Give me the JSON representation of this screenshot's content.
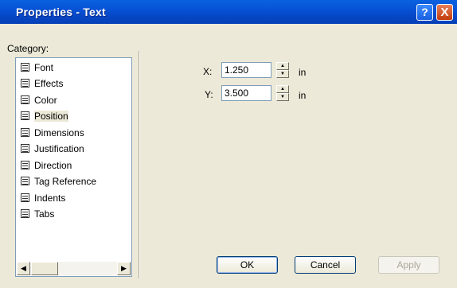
{
  "window": {
    "title": "Properties - Text",
    "help_label": "?",
    "close_label": "X"
  },
  "category": {
    "label": "Category:",
    "items": [
      {
        "label": "Font"
      },
      {
        "label": "Effects"
      },
      {
        "label": "Color"
      },
      {
        "label": "Position",
        "selected": true
      },
      {
        "label": "Dimensions"
      },
      {
        "label": "Justification"
      },
      {
        "label": "Direction"
      },
      {
        "label": "Tag Reference"
      },
      {
        "label": "Indents"
      },
      {
        "label": "Tabs"
      }
    ],
    "scroll_left": "◀",
    "scroll_right": "▶"
  },
  "position": {
    "x_label": "X:",
    "x_value": "1.250",
    "y_label": "Y:",
    "y_value": "3.500",
    "unit": "in",
    "spin_up": "▲",
    "spin_down": "▼"
  },
  "buttons": {
    "ok": "OK",
    "cancel": "Cancel",
    "apply": "Apply"
  }
}
